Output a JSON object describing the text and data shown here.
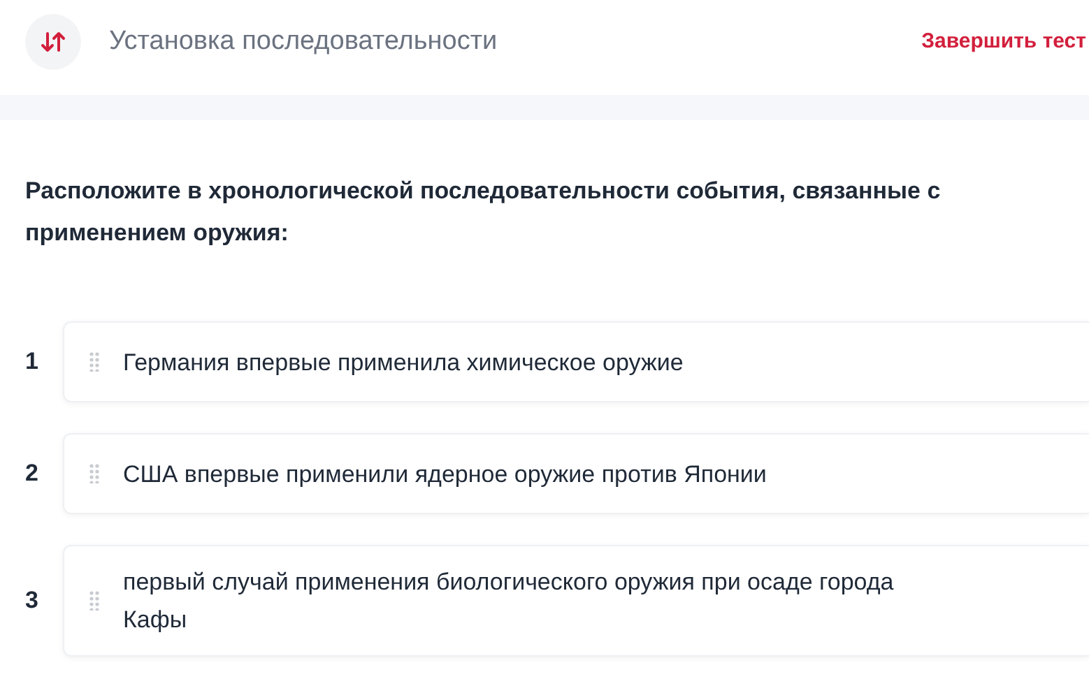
{
  "header": {
    "title": "Установка последовательности",
    "finish_button": "Завершить тест"
  },
  "question": "Расположите в хронологической последовательности события, связанные с применением оружия:",
  "items": [
    {
      "number": "1",
      "text": "Германия впервые применила химическое оружие"
    },
    {
      "number": "2",
      "text": "США впервые применили ядерное оружие против Японии"
    },
    {
      "number": "3",
      "text": "первый случай применения биологического оружия при осаде города Кафы"
    }
  ]
}
